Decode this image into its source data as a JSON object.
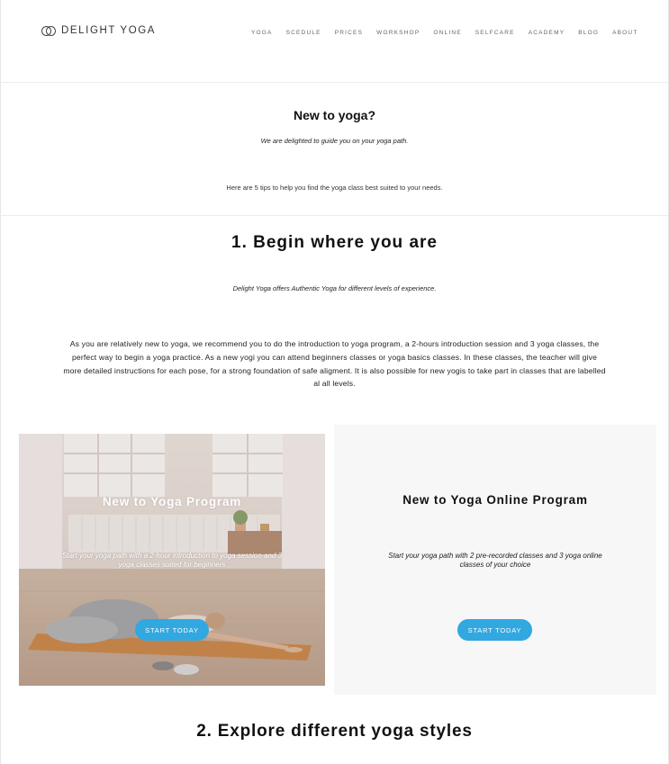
{
  "header": {
    "logo_text": "DELIGHT YOGA",
    "nav": [
      "YOGA",
      "SCEDULE",
      "PRICES",
      "WORKSHOP",
      "ONLINE",
      "SELFCARE",
      "ACADEMY",
      "BLOG",
      "ABOUT"
    ]
  },
  "intro": {
    "title": "New to yoga?",
    "subtitle": "We are delighted to guide you on your yoga path.",
    "tips": "Here are 5 tips to help you find the yoga class best suited to your needs."
  },
  "section1": {
    "title": "1. Begin where you are",
    "subtitle": "Delight Yoga offers Authentic Yoga for different levels of experience.",
    "body": "As you are relatively new to yoga, we recommend you to do the introduction to yoga program, a 2-hours introduction session and 3 yoga classes, the perfect way to begin a yoga practice. As a new yogi you can attend beginners classes or yoga basics classes. In these classes, the teacher will give more detailed instructions for each pose, for a strong foundation of safe aligment. It is also possible for new yogis to take part in classes that are labelled al all levels."
  },
  "cards": [
    {
      "title": "New to Yoga Program",
      "text": "Start your yoga path with a 2-hour introduction to yoga session and 3 yoga classes suited for beginners",
      "button": "START TODAY"
    },
    {
      "title": "New to Yoga Online Program",
      "text": "Start your yoga path with 2 pre-recorded classes and 3 yoga online classes of your choice",
      "button": "START TODAY"
    }
  ],
  "section2": {
    "title": "2. Explore different yoga styles"
  },
  "colors": {
    "accent": "#32a8e0",
    "card_bg": "#f7f7f7"
  },
  "icons": [
    "logo-rings-icon"
  ]
}
